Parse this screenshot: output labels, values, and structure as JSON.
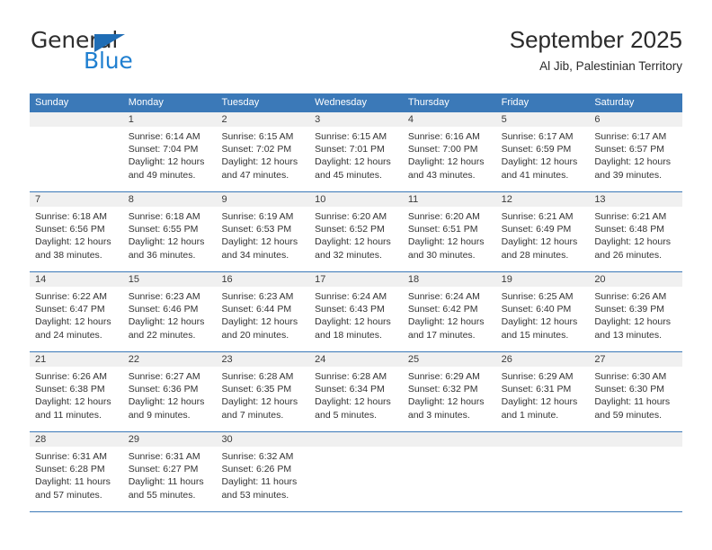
{
  "brand": {
    "name_top": "General",
    "name_bottom": "Blue",
    "accent_color": "#1f7fd0",
    "triangle_color": "#1f6db5"
  },
  "header": {
    "title": "September 2025",
    "location": "Al Jib, Palestinian Territory"
  },
  "calendar": {
    "header_bg": "#3b79b8",
    "daynum_bg": "#f0f0f0",
    "weekdays": [
      "Sunday",
      "Monday",
      "Tuesday",
      "Wednesday",
      "Thursday",
      "Friday",
      "Saturday"
    ],
    "weeks": [
      [
        {
          "day": "",
          "sunrise": "",
          "sunset": "",
          "daylight1": "",
          "daylight2": ""
        },
        {
          "day": "1",
          "sunrise": "Sunrise: 6:14 AM",
          "sunset": "Sunset: 7:04 PM",
          "daylight1": "Daylight: 12 hours",
          "daylight2": "and 49 minutes."
        },
        {
          "day": "2",
          "sunrise": "Sunrise: 6:15 AM",
          "sunset": "Sunset: 7:02 PM",
          "daylight1": "Daylight: 12 hours",
          "daylight2": "and 47 minutes."
        },
        {
          "day": "3",
          "sunrise": "Sunrise: 6:15 AM",
          "sunset": "Sunset: 7:01 PM",
          "daylight1": "Daylight: 12 hours",
          "daylight2": "and 45 minutes."
        },
        {
          "day": "4",
          "sunrise": "Sunrise: 6:16 AM",
          "sunset": "Sunset: 7:00 PM",
          "daylight1": "Daylight: 12 hours",
          "daylight2": "and 43 minutes."
        },
        {
          "day": "5",
          "sunrise": "Sunrise: 6:17 AM",
          "sunset": "Sunset: 6:59 PM",
          "daylight1": "Daylight: 12 hours",
          "daylight2": "and 41 minutes."
        },
        {
          "day": "6",
          "sunrise": "Sunrise: 6:17 AM",
          "sunset": "Sunset: 6:57 PM",
          "daylight1": "Daylight: 12 hours",
          "daylight2": "and 39 minutes."
        }
      ],
      [
        {
          "day": "7",
          "sunrise": "Sunrise: 6:18 AM",
          "sunset": "Sunset: 6:56 PM",
          "daylight1": "Daylight: 12 hours",
          "daylight2": "and 38 minutes."
        },
        {
          "day": "8",
          "sunrise": "Sunrise: 6:18 AM",
          "sunset": "Sunset: 6:55 PM",
          "daylight1": "Daylight: 12 hours",
          "daylight2": "and 36 minutes."
        },
        {
          "day": "9",
          "sunrise": "Sunrise: 6:19 AM",
          "sunset": "Sunset: 6:53 PM",
          "daylight1": "Daylight: 12 hours",
          "daylight2": "and 34 minutes."
        },
        {
          "day": "10",
          "sunrise": "Sunrise: 6:20 AM",
          "sunset": "Sunset: 6:52 PM",
          "daylight1": "Daylight: 12 hours",
          "daylight2": "and 32 minutes."
        },
        {
          "day": "11",
          "sunrise": "Sunrise: 6:20 AM",
          "sunset": "Sunset: 6:51 PM",
          "daylight1": "Daylight: 12 hours",
          "daylight2": "and 30 minutes."
        },
        {
          "day": "12",
          "sunrise": "Sunrise: 6:21 AM",
          "sunset": "Sunset: 6:49 PM",
          "daylight1": "Daylight: 12 hours",
          "daylight2": "and 28 minutes."
        },
        {
          "day": "13",
          "sunrise": "Sunrise: 6:21 AM",
          "sunset": "Sunset: 6:48 PM",
          "daylight1": "Daylight: 12 hours",
          "daylight2": "and 26 minutes."
        }
      ],
      [
        {
          "day": "14",
          "sunrise": "Sunrise: 6:22 AM",
          "sunset": "Sunset: 6:47 PM",
          "daylight1": "Daylight: 12 hours",
          "daylight2": "and 24 minutes."
        },
        {
          "day": "15",
          "sunrise": "Sunrise: 6:23 AM",
          "sunset": "Sunset: 6:46 PM",
          "daylight1": "Daylight: 12 hours",
          "daylight2": "and 22 minutes."
        },
        {
          "day": "16",
          "sunrise": "Sunrise: 6:23 AM",
          "sunset": "Sunset: 6:44 PM",
          "daylight1": "Daylight: 12 hours",
          "daylight2": "and 20 minutes."
        },
        {
          "day": "17",
          "sunrise": "Sunrise: 6:24 AM",
          "sunset": "Sunset: 6:43 PM",
          "daylight1": "Daylight: 12 hours",
          "daylight2": "and 18 minutes."
        },
        {
          "day": "18",
          "sunrise": "Sunrise: 6:24 AM",
          "sunset": "Sunset: 6:42 PM",
          "daylight1": "Daylight: 12 hours",
          "daylight2": "and 17 minutes."
        },
        {
          "day": "19",
          "sunrise": "Sunrise: 6:25 AM",
          "sunset": "Sunset: 6:40 PM",
          "daylight1": "Daylight: 12 hours",
          "daylight2": "and 15 minutes."
        },
        {
          "day": "20",
          "sunrise": "Sunrise: 6:26 AM",
          "sunset": "Sunset: 6:39 PM",
          "daylight1": "Daylight: 12 hours",
          "daylight2": "and 13 minutes."
        }
      ],
      [
        {
          "day": "21",
          "sunrise": "Sunrise: 6:26 AM",
          "sunset": "Sunset: 6:38 PM",
          "daylight1": "Daylight: 12 hours",
          "daylight2": "and 11 minutes."
        },
        {
          "day": "22",
          "sunrise": "Sunrise: 6:27 AM",
          "sunset": "Sunset: 6:36 PM",
          "daylight1": "Daylight: 12 hours",
          "daylight2": "and 9 minutes."
        },
        {
          "day": "23",
          "sunrise": "Sunrise: 6:28 AM",
          "sunset": "Sunset: 6:35 PM",
          "daylight1": "Daylight: 12 hours",
          "daylight2": "and 7 minutes."
        },
        {
          "day": "24",
          "sunrise": "Sunrise: 6:28 AM",
          "sunset": "Sunset: 6:34 PM",
          "daylight1": "Daylight: 12 hours",
          "daylight2": "and 5 minutes."
        },
        {
          "day": "25",
          "sunrise": "Sunrise: 6:29 AM",
          "sunset": "Sunset: 6:32 PM",
          "daylight1": "Daylight: 12 hours",
          "daylight2": "and 3 minutes."
        },
        {
          "day": "26",
          "sunrise": "Sunrise: 6:29 AM",
          "sunset": "Sunset: 6:31 PM",
          "daylight1": "Daylight: 12 hours",
          "daylight2": "and 1 minute."
        },
        {
          "day": "27",
          "sunrise": "Sunrise: 6:30 AM",
          "sunset": "Sunset: 6:30 PM",
          "daylight1": "Daylight: 11 hours",
          "daylight2": "and 59 minutes."
        }
      ],
      [
        {
          "day": "28",
          "sunrise": "Sunrise: 6:31 AM",
          "sunset": "Sunset: 6:28 PM",
          "daylight1": "Daylight: 11 hours",
          "daylight2": "and 57 minutes."
        },
        {
          "day": "29",
          "sunrise": "Sunrise: 6:31 AM",
          "sunset": "Sunset: 6:27 PM",
          "daylight1": "Daylight: 11 hours",
          "daylight2": "and 55 minutes."
        },
        {
          "day": "30",
          "sunrise": "Sunrise: 6:32 AM",
          "sunset": "Sunset: 6:26 PM",
          "daylight1": "Daylight: 11 hours",
          "daylight2": "and 53 minutes."
        },
        {
          "day": "",
          "sunrise": "",
          "sunset": "",
          "daylight1": "",
          "daylight2": ""
        },
        {
          "day": "",
          "sunrise": "",
          "sunset": "",
          "daylight1": "",
          "daylight2": ""
        },
        {
          "day": "",
          "sunrise": "",
          "sunset": "",
          "daylight1": "",
          "daylight2": ""
        },
        {
          "day": "",
          "sunrise": "",
          "sunset": "",
          "daylight1": "",
          "daylight2": ""
        }
      ]
    ]
  }
}
